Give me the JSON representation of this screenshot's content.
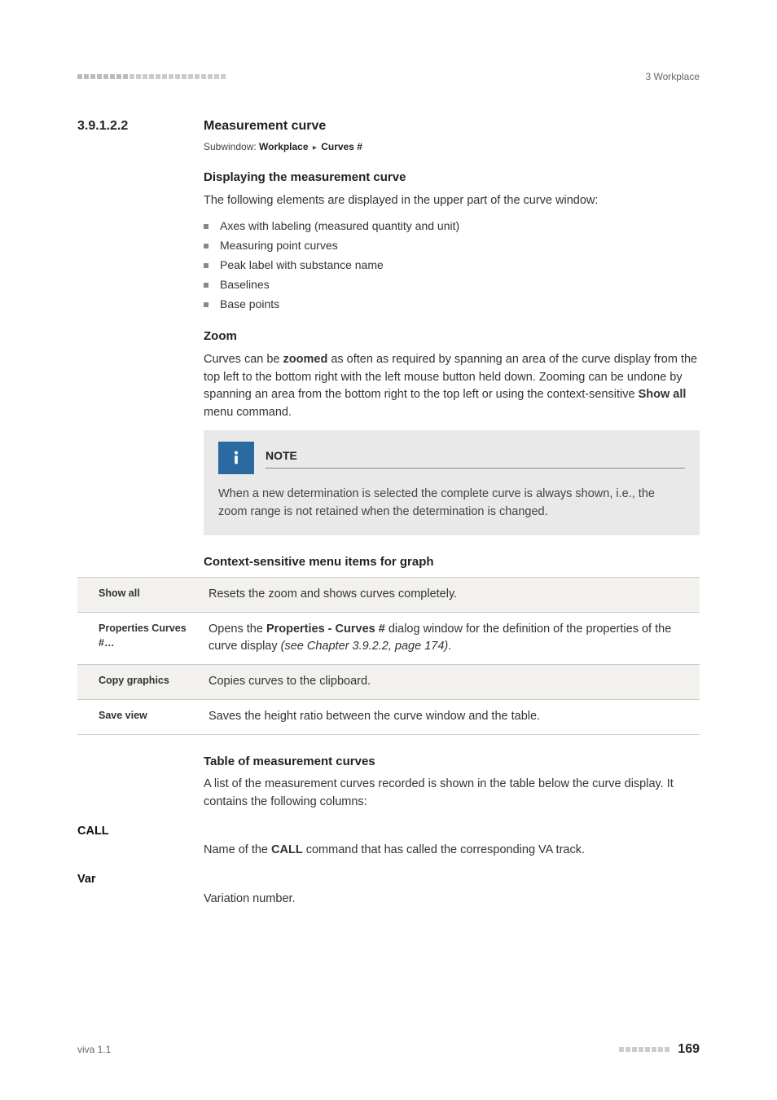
{
  "header": {
    "right": "3 Workplace"
  },
  "section": {
    "number": "3.9.1.2.2",
    "title": "Measurement curve"
  },
  "subwindow": {
    "label": "Subwindow",
    "path1": "Workplace",
    "path2": "Curves #"
  },
  "display": {
    "heading": "Displaying the measurement curve",
    "intro": "The following elements are displayed in the upper part of the curve window:",
    "bullets": [
      "Axes with labeling (measured quantity and unit)",
      "Measuring point curves",
      "Peak label with substance name",
      "Baselines",
      "Base points"
    ]
  },
  "zoom": {
    "heading": "Zoom",
    "p1a": "Curves can be ",
    "p1b": "zoomed",
    "p1c": " as often as required by spanning an area of the curve display from the top left to the bottom right with the left mouse button held down. Zooming can be undone by spanning an area from the bottom right to the top left or using the context-sensitive ",
    "p1d": "Show all",
    "p1e": " menu command."
  },
  "note": {
    "title": "NOTE",
    "body": "When a new determination is selected the complete curve is always shown, i.e., the zoom range is not retained when the determination is changed."
  },
  "context": {
    "heading": "Context-sensitive menu items for graph",
    "rows": [
      {
        "k": "Show all",
        "v": "Resets the zoom and shows curves completely."
      },
      {
        "k": "Properties Curves #…",
        "v_a": "Opens the ",
        "v_b": "Properties - Curves #",
        "v_c": " dialog window for the definition of the properties of the curve display ",
        "v_see": "(see Chapter 3.9.2.2, page 174)",
        "v_end": "."
      },
      {
        "k": "Copy graphics",
        "v": "Copies curves to the clipboard."
      },
      {
        "k": "Save view",
        "v": "Saves the height ratio between the curve window and the table."
      }
    ]
  },
  "tablecurves": {
    "heading": "Table of measurement curves",
    "intro": "A list of the measurement curves recorded is shown in the table below the curve display. It contains the following columns:"
  },
  "call": {
    "term": "CALL",
    "desc_a": "Name of the ",
    "desc_b": "CALL",
    "desc_c": " command that has called the corresponding VA track."
  },
  "var": {
    "term": "Var",
    "desc": "Variation number."
  },
  "footer": {
    "left": "viva 1.1",
    "page": "169"
  }
}
